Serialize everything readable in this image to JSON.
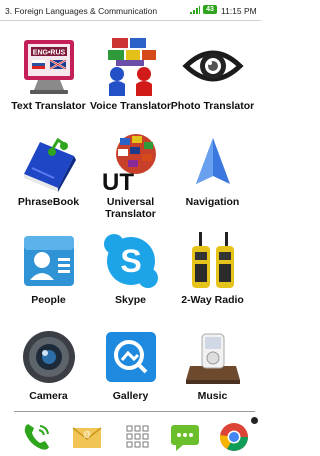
{
  "status_bar": {
    "title": "3. Foreign Languages & Communication",
    "battery": "43",
    "time": "11:15 PM"
  },
  "apps": [
    {
      "label": "Text Translator",
      "icon": "text-translator-icon"
    },
    {
      "label": "Voice Translator",
      "icon": "voice-translator-icon"
    },
    {
      "label": "Photo Translator",
      "icon": "photo-translator-icon"
    },
    {
      "label": "PhraseBook",
      "icon": "phrasebook-icon"
    },
    {
      "label": "Universal Translator",
      "icon": "universal-translator-icon"
    },
    {
      "label": "Navigation",
      "icon": "navigation-icon"
    },
    {
      "label": "People",
      "icon": "people-icon"
    },
    {
      "label": "Skype",
      "icon": "skype-icon"
    },
    {
      "label": "2-Way Radio",
      "icon": "two-way-radio-icon"
    },
    {
      "label": "Camera",
      "icon": "camera-icon"
    },
    {
      "label": "Gallery",
      "icon": "gallery-icon"
    },
    {
      "label": "Music",
      "icon": "music-icon"
    }
  ],
  "icon_text": {
    "eng_rus": "ENG•RUS",
    "ut": "UT"
  },
  "dock": [
    {
      "icon": "phone-icon"
    },
    {
      "icon": "email-icon"
    },
    {
      "icon": "app-drawer-icon"
    },
    {
      "icon": "messaging-icon"
    },
    {
      "icon": "chrome-icon"
    }
  ]
}
